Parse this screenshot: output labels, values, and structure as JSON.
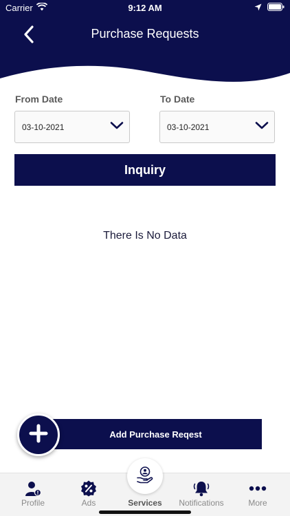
{
  "status_bar": {
    "carrier": "Carrier",
    "time": "9:12 AM",
    "icons": [
      "wifi-icon",
      "location-arrow-icon",
      "battery-icon"
    ]
  },
  "header": {
    "title": "Purchase Requests",
    "back_icon": "chevron-left-icon"
  },
  "filters": {
    "from_label": "From Date",
    "from_value": "03-10-2021",
    "to_label": "To Date",
    "to_value": "03-10-2021"
  },
  "inquiry_label": "Inquiry",
  "empty_message": "There Is No Data",
  "add_button_label": "Add Purchase Reqest",
  "tabs": [
    {
      "label": "Profile",
      "icon": "profile-icon",
      "active": false
    },
    {
      "label": "Ads",
      "icon": "percent-badge-icon",
      "active": false
    },
    {
      "label": "Services",
      "icon": "services-hand-icon",
      "active": true
    },
    {
      "label": "Notifications",
      "icon": "bell-icon",
      "active": false
    },
    {
      "label": "More",
      "icon": "more-dots-icon",
      "active": false
    }
  ],
  "colors": {
    "primary": "#0c0f4d",
    "background": "#ffffff",
    "tabbar": "#f3f3f3",
    "label_gray": "#5a5a5a",
    "inactive_tab": "#8a8a8a"
  }
}
